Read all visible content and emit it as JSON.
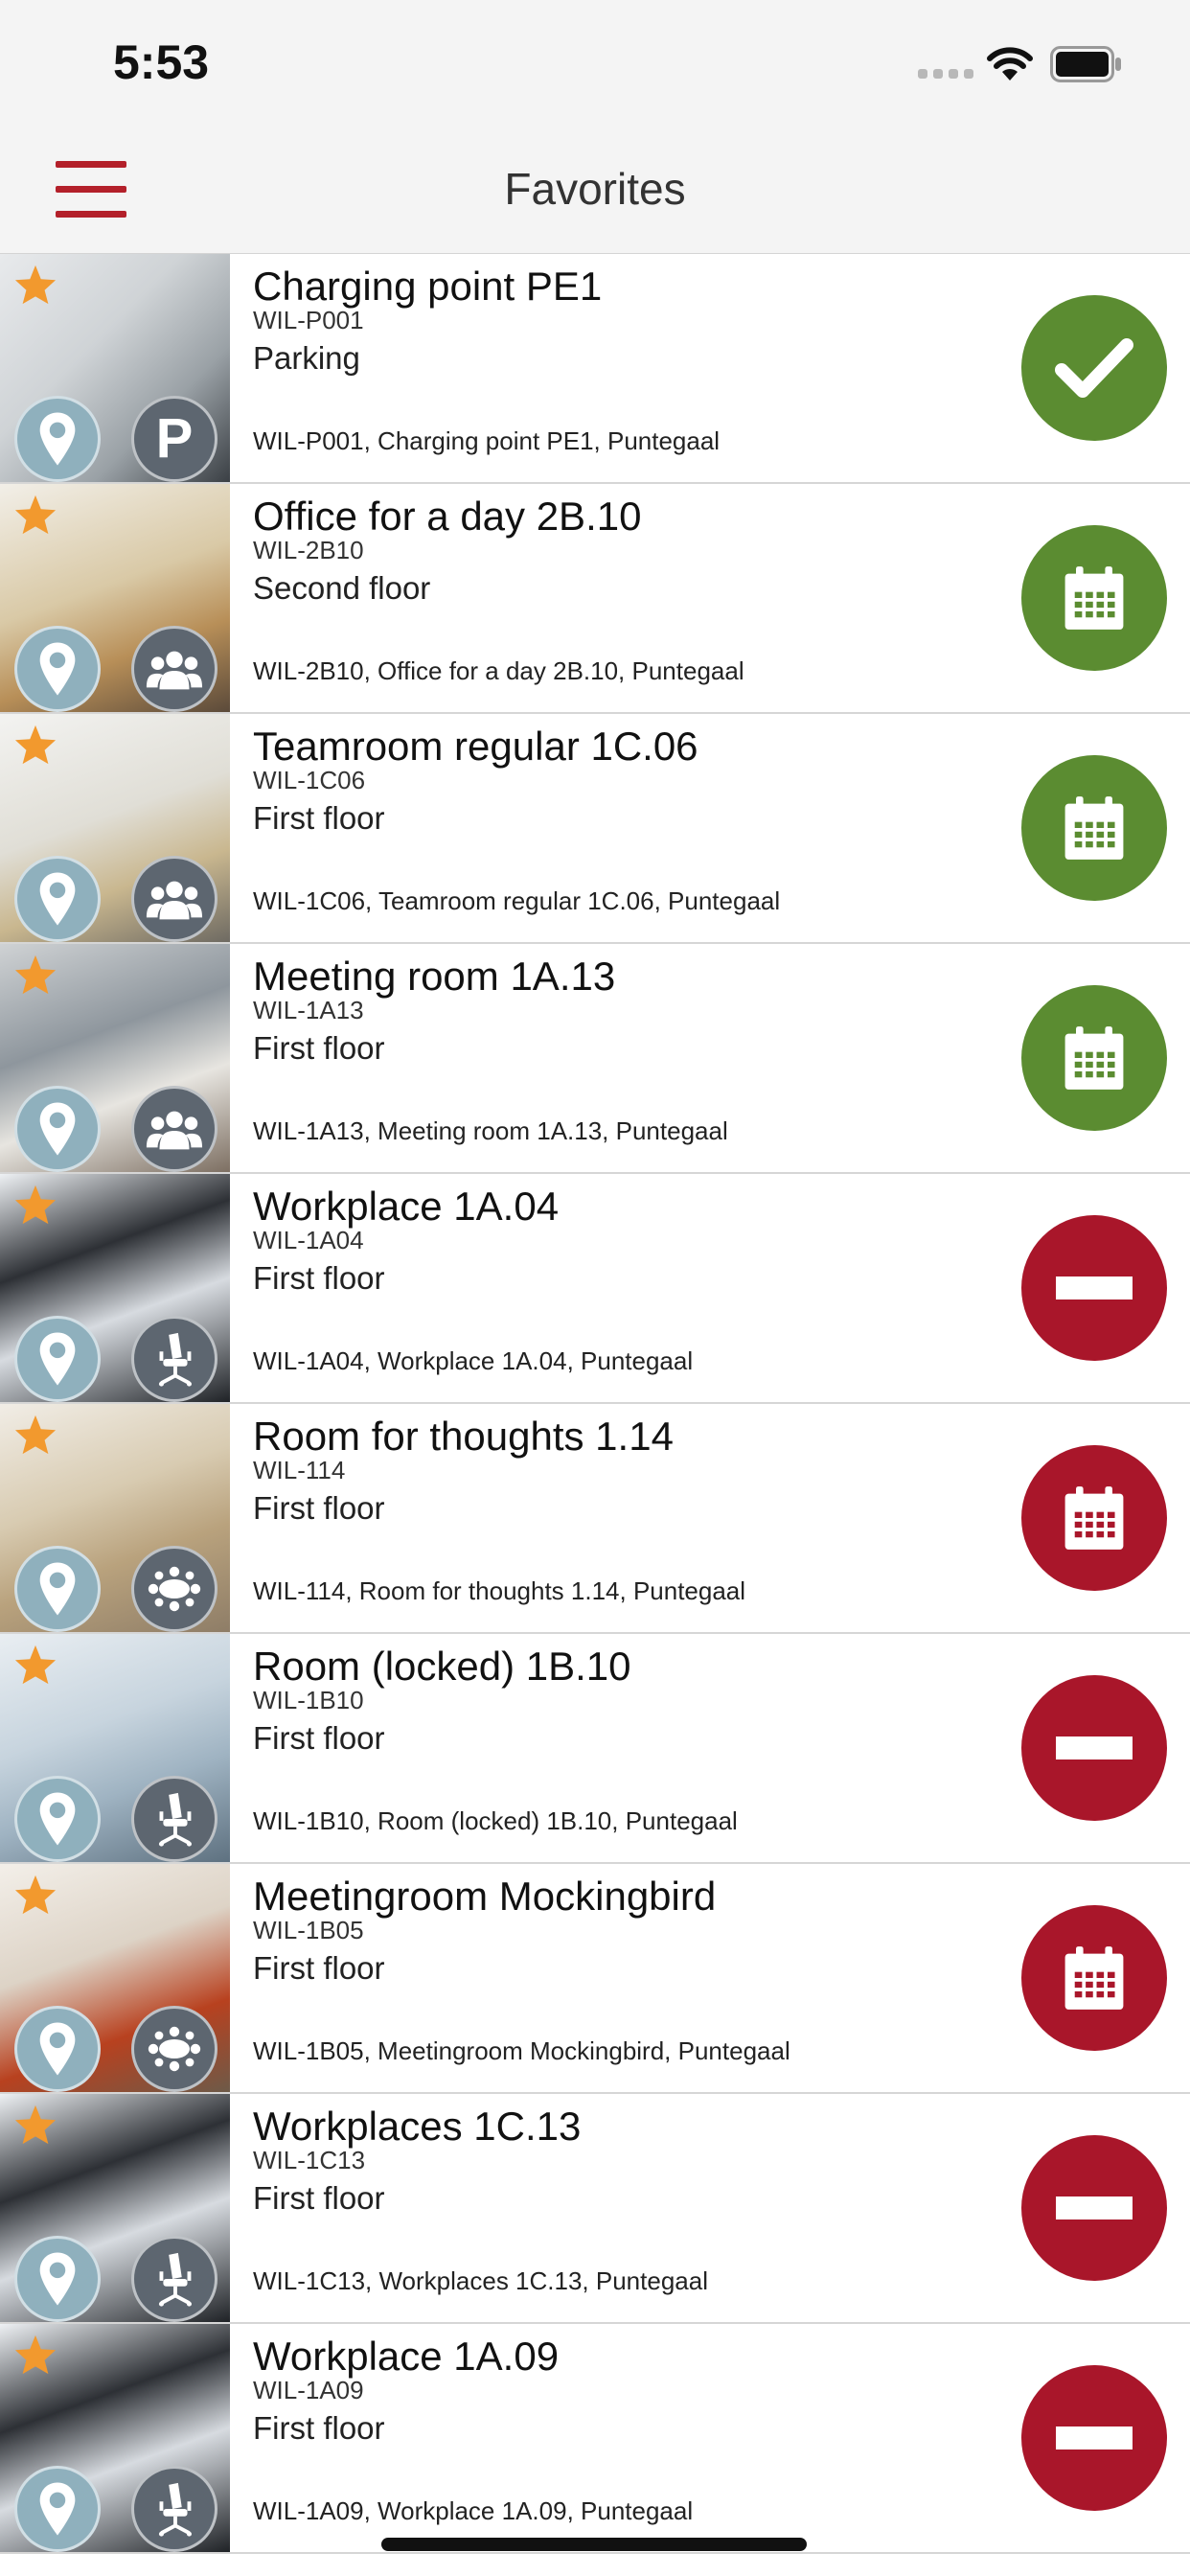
{
  "status_bar": {
    "time": "5:53"
  },
  "nav": {
    "title": "Favorites"
  },
  "colors": {
    "accent": "#b3202a",
    "available": "#5b8c31",
    "unavailable": "#a9162a",
    "star": "#f2992e"
  },
  "items": [
    {
      "name": "Charging point PE1",
      "code": "WIL-P001",
      "floor": "Parking",
      "address": "WIL-P001, Charging point PE1, Puntegaal",
      "type_icon": "parking-icon",
      "action_icon": "check-icon",
      "status": "available"
    },
    {
      "name": "Office for a day 2B.10",
      "code": "WIL-2B10",
      "floor": "Second floor",
      "address": "WIL-2B10, Office for a day 2B.10, Puntegaal",
      "type_icon": "group-icon",
      "action_icon": "calendar-icon",
      "status": "available"
    },
    {
      "name": "Teamroom regular 1C.06",
      "code": "WIL-1C06",
      "floor": "First floor",
      "address": "WIL-1C06, Teamroom regular 1C.06, Puntegaal",
      "type_icon": "group-icon",
      "action_icon": "calendar-icon",
      "status": "available"
    },
    {
      "name": "Meeting room 1A.13",
      "code": "WIL-1A13",
      "floor": "First floor",
      "address": "WIL-1A13, Meeting room 1A.13, Puntegaal",
      "type_icon": "group-icon",
      "action_icon": "calendar-icon",
      "status": "available"
    },
    {
      "name": "Workplace 1A.04",
      "code": "WIL-1A04",
      "floor": "First floor",
      "address": "WIL-1A04, Workplace 1A.04, Puntegaal",
      "type_icon": "chair-icon",
      "action_icon": "minus-icon",
      "status": "unavailable"
    },
    {
      "name": "Room for thoughts 1.14",
      "code": "WIL-114",
      "floor": "First floor",
      "address": "WIL-114, Room for thoughts 1.14, Puntegaal",
      "type_icon": "meeting-table-icon",
      "action_icon": "calendar-icon",
      "status": "unavailable"
    },
    {
      "name": "Room (locked) 1B.10",
      "code": "WIL-1B10",
      "floor": "First floor",
      "address": "WIL-1B10, Room (locked) 1B.10, Puntegaal",
      "type_icon": "chair-icon",
      "action_icon": "minus-icon",
      "status": "unavailable"
    },
    {
      "name": "Meetingroom Mockingbird",
      "code": "WIL-1B05",
      "floor": "First floor",
      "address": "WIL-1B05, Meetingroom Mockingbird, Puntegaal",
      "type_icon": "meeting-table-icon",
      "action_icon": "calendar-icon",
      "status": "unavailable"
    },
    {
      "name": "Workplaces 1C.13",
      "code": "WIL-1C13",
      "floor": "First floor",
      "address": "WIL-1C13, Workplaces 1C.13, Puntegaal",
      "type_icon": "chair-icon",
      "action_icon": "minus-icon",
      "status": "unavailable"
    },
    {
      "name": "Workplace 1A.09",
      "code": "WIL-1A09",
      "floor": "First floor",
      "address": "WIL-1A09, Workplace 1A.09, Puntegaal",
      "type_icon": "chair-icon",
      "action_icon": "minus-icon",
      "status": "unavailable"
    }
  ]
}
